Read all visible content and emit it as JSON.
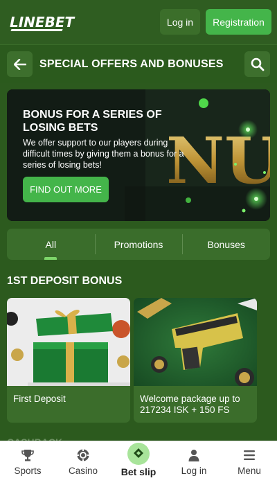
{
  "header": {
    "logo_text": "LINEBET",
    "login_label": "Log in",
    "registration_label": "Registration"
  },
  "section": {
    "title": "SPECIAL OFFERS AND BONUSES",
    "back_icon": "arrow-left-icon",
    "search_icon": "search-icon"
  },
  "banner": {
    "title": "BONUS FOR A SERIES OF LOSING BETS",
    "text": "We offer support to our players during difficult times by giving them a bonus for a series of losing bets!",
    "button_label": "FIND OUT MORE",
    "art_text": "NUS"
  },
  "tabs": [
    {
      "label": "All",
      "active": true
    },
    {
      "label": "Promotions",
      "active": false
    },
    {
      "label": "Bonuses",
      "active": false
    }
  ],
  "deposit_section": {
    "heading": "1ST DEPOSIT BONUS",
    "cards": [
      {
        "label": "First Deposit",
        "image": "gift-box-image"
      },
      {
        "label": "Welcome package up to 217234 ISK + 150 FS",
        "image": "cash-gun-image"
      }
    ]
  },
  "next_section": {
    "heading": "CASHBACK"
  },
  "bottom_nav": [
    {
      "label": "Sports",
      "icon": "trophy-icon"
    },
    {
      "label": "Casino",
      "icon": "casino-chip-icon"
    },
    {
      "label": "Bet slip",
      "icon": "ticket-icon"
    },
    {
      "label": "Log in",
      "icon": "user-icon"
    },
    {
      "label": "Menu",
      "icon": "menu-icon"
    }
  ],
  "colors": {
    "accent_green": "#44b54a",
    "header_bg": "#2f5d21",
    "panel_bg": "#3b6d2b"
  }
}
